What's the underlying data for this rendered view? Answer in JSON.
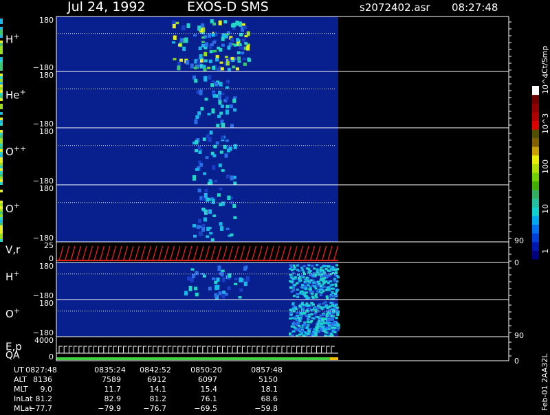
{
  "header": {
    "date": "Jul 24, 1992",
    "instrument": "EXOS-D SMS",
    "file": "s2072402.asr",
    "time": "08:27:48"
  },
  "colorbar": {
    "label": "Ct/Smp",
    "tick_labels": [
      "1",
      "10",
      "100",
      "10^3",
      "10^4"
    ],
    "scale": "log",
    "colors": [
      "#000080",
      "#0018b0",
      "#0040d8",
      "#0070f0",
      "#00a8f0",
      "#10d0d0",
      "#20c0a0",
      "#30b060",
      "#40b000",
      "#70d000",
      "#b0e000",
      "#e8f000",
      "#c8a000",
      "#806000",
      "#505000",
      "#e00000",
      "#b00000",
      "#900000",
      "#700000",
      "#ffffff"
    ]
  },
  "panels": [
    {
      "label": "H",
      "sup": "+",
      "ytop": "180",
      "ybot": "−180"
    },
    {
      "label": "He",
      "sup": "+",
      "ytop": "180",
      "ybot": "−180"
    },
    {
      "label": "O",
      "sup": "++",
      "ytop": "180",
      "ybot": "−180"
    },
    {
      "label": "O",
      "sup": "+",
      "ytop": "180",
      "ybot": "−180"
    },
    {
      "label": "V,r",
      "sup": "",
      "ytop": "25",
      "ybot": "0",
      "right_top": "90",
      "right_bot": "0"
    },
    {
      "label": "H",
      "sup": "+",
      "ytop": "180",
      "ybot": "−180"
    },
    {
      "label": "O",
      "sup": "+",
      "ytop": "180",
      "ybot": "−180"
    },
    {
      "label": "E,p",
      "sup": "",
      "label2": "QA",
      "ytop": "4000",
      "ybot": "0",
      "right_top": "90",
      "right_bot": "0"
    }
  ],
  "footer": {
    "row_labels": [
      "UT",
      "ALT",
      "MLT",
      "InLat",
      "MLat"
    ],
    "columns": [
      [
        "0827:48",
        "8136",
        "9.0",
        "81.2",
        "−77.7"
      ],
      [
        "0835:24",
        "7589",
        "11.7",
        "82.9",
        "−79.9"
      ],
      [
        "0842:52",
        "6912",
        "14.1",
        "81.2",
        "−76.7"
      ],
      [
        "0850:20",
        "6097",
        "15.4",
        "76.1",
        "−69.5"
      ],
      [
        "0857:48",
        "5150",
        "18.1",
        "68.6",
        "−59.8"
      ]
    ],
    "side_note": "Feb-01 2AA32L"
  },
  "chart_data": {
    "type": "heatmap",
    "title": "Jul 24, 1992 EXOS-D SMS",
    "x_ticks": [
      "0827:48",
      "0835:24",
      "0842:52",
      "0850:20",
      "0857:48"
    ],
    "series": [
      {
        "name": "H+",
        "ylim": [
          -180,
          180
        ]
      },
      {
        "name": "He+",
        "ylim": [
          -180,
          180
        ]
      },
      {
        "name": "O++",
        "ylim": [
          -180,
          180
        ]
      },
      {
        "name": "O+",
        "ylim": [
          -180,
          180
        ]
      },
      {
        "name": "V,r",
        "ylim": [
          0,
          25
        ],
        "right_ylim": [
          0,
          90
        ]
      },
      {
        "name": "H+",
        "ylim": [
          -180,
          180
        ]
      },
      {
        "name": "O+",
        "ylim": [
          -180,
          180
        ]
      },
      {
        "name": "E,p",
        "ylim": [
          0,
          4000
        ],
        "right_ylim": [
          0,
          90
        ]
      }
    ],
    "colorbar_range": [
      1,
      10000
    ],
    "colorbar_units": "Ct/Smp"
  }
}
